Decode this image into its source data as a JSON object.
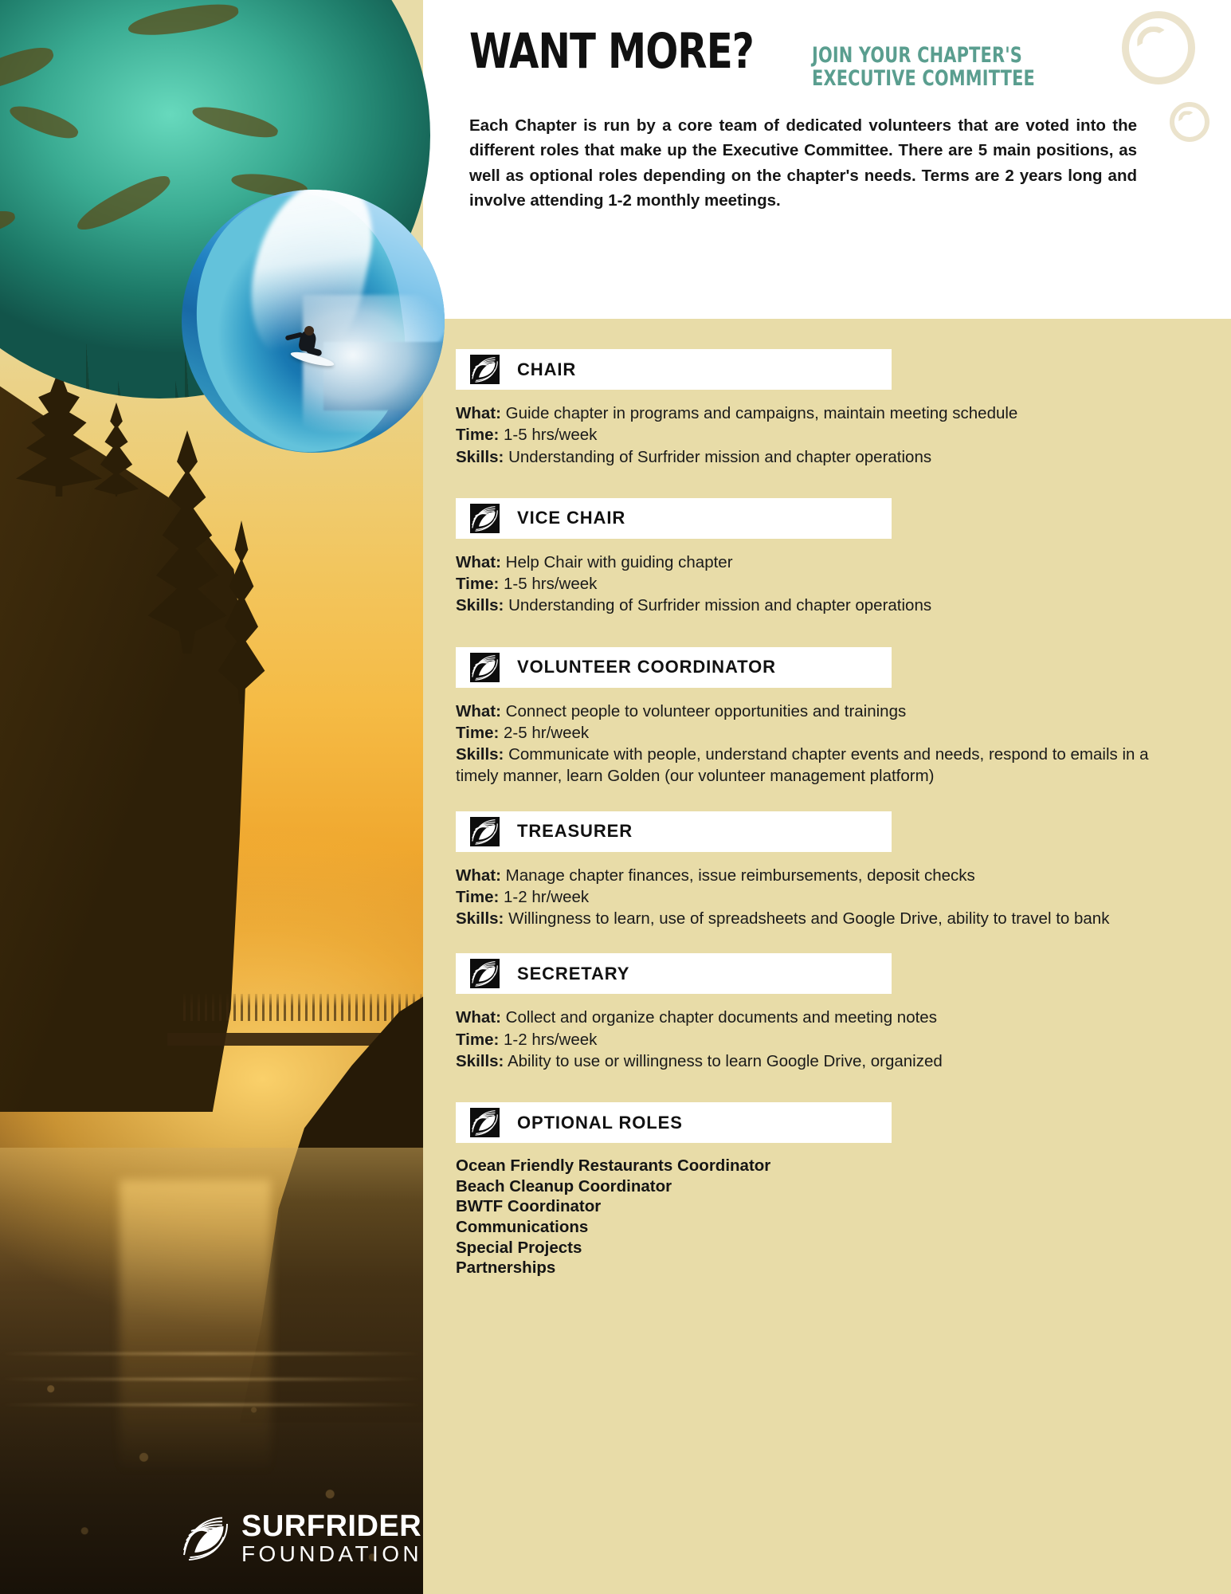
{
  "header": {
    "headline": "WANT MORE?",
    "subhead_line1": "JOIN YOUR CHAPTER'S",
    "subhead_line2": "EXECUTIVE COMMITTEE",
    "intro": "Each Chapter is run by a core team of dedicated volunteers that are voted into the different roles that make up the Executive Committee. There are 5 main positions, as well as optional roles depending on the chapter's needs. Terms are 2 years long and involve attending 1-2 monthly meetings.",
    "accent_color": "#5A9E8F",
    "bubble_color": "#EBE3CC"
  },
  "labels": {
    "what": "What:",
    "time": "Time:",
    "skills": "Skills:"
  },
  "roles": [
    {
      "name": "CHAIR",
      "what": "Guide chapter in programs and campaigns, maintain meeting schedule",
      "time": "1-5 hrs/week",
      "skills": "Understanding of Surfrider mission and chapter operations"
    },
    {
      "name": "VICE CHAIR",
      "what": "Help Chair with guiding chapter",
      "time": "1-5 hrs/week",
      "skills": "Understanding of Surfrider mission and chapter operations"
    },
    {
      "name": "VOLUNTEER COORDINATOR",
      "what": "Connect people to volunteer opportunities and trainings",
      "time": "2-5 hr/week",
      "skills": "Communicate with people, understand chapter events and needs, respond to emails in a timely manner, learn Golden (our volunteer management platform)"
    },
    {
      "name": "TREASURER",
      "what": "Manage chapter finances, issue reimbursements, deposit checks",
      "time": "1-2 hr/week",
      "skills": "Willingness to learn, use of spreadsheets and Google Drive, ability to travel to bank"
    },
    {
      "name": "SECRETARY",
      "what": "Collect and organize chapter documents and meeting notes",
      "time": "1-2 hrs/week",
      "skills": "Ability to use or willingness to learn Google Drive, organized"
    }
  ],
  "optional": {
    "name": "OPTIONAL ROLES",
    "items": [
      "Ocean Friendly Restaurants Coordinator",
      "Beach Cleanup Coordinator",
      "BWTF Coordinator",
      "Communications",
      "Special Projects",
      "Partnerships"
    ]
  },
  "brand": {
    "line1": "SURFRIDER",
    "line2": "FOUNDATION"
  },
  "theme": {
    "background_tan": "#E8DCA8",
    "header_white": "#FFFFFF",
    "text_dark": "#111111"
  }
}
